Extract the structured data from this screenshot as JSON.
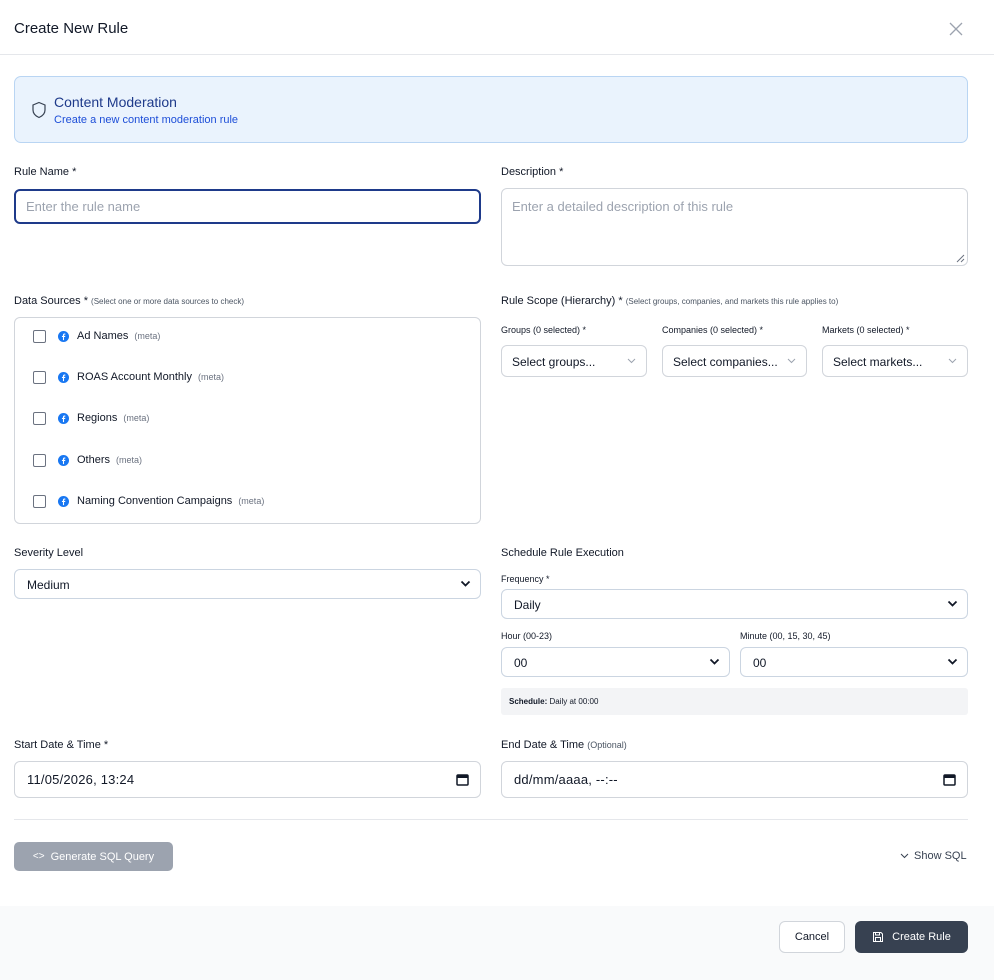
{
  "modal": {
    "title": "Create New Rule"
  },
  "banner": {
    "title": "Content Moderation",
    "subtitle": "Create a new content moderation rule"
  },
  "rule_name": {
    "label": "Rule Name *",
    "placeholder": "Enter the rule name",
    "value": ""
  },
  "description": {
    "label": "Description *",
    "placeholder": "Enter a detailed description of this rule",
    "value": ""
  },
  "data_sources": {
    "label": "Data Sources *",
    "hint": "(Select one or more data sources to check)",
    "items": [
      {
        "name": "Ad Names",
        "tag": "(meta)",
        "checked": false
      },
      {
        "name": "ROAS Account Monthly",
        "tag": "(meta)",
        "checked": false
      },
      {
        "name": "Regions",
        "tag": "(meta)",
        "checked": false
      },
      {
        "name": "Others",
        "tag": "(meta)",
        "checked": false
      },
      {
        "name": "Naming Convention Campaigns",
        "tag": "(meta)",
        "checked": false
      }
    ]
  },
  "rule_scope": {
    "label": "Rule Scope (Hierarchy) *",
    "hint": "(Select groups, companies, and markets this rule applies to)",
    "groups": {
      "label": "Groups (0 selected) *",
      "placeholder": "Select groups..."
    },
    "companies": {
      "label": "Companies (0 selected) *",
      "placeholder": "Select companies..."
    },
    "markets": {
      "label": "Markets (0 selected) *",
      "placeholder": "Select markets..."
    }
  },
  "severity": {
    "label": "Severity Level",
    "value": "Medium"
  },
  "schedule": {
    "label": "Schedule Rule Execution",
    "frequency_label": "Frequency *",
    "frequency_value": "Daily",
    "hour_label": "Hour (00-23)",
    "hour_value": "00",
    "minute_label": "Minute (00, 15, 30, 45)",
    "minute_value": "00",
    "note_prefix": "Schedule:",
    "note_text": "Daily at 00:00"
  },
  "start_datetime": {
    "label": "Start Date & Time *",
    "value": "11/05/2026, 13:24"
  },
  "end_datetime": {
    "label": "End Date & Time",
    "hint": "(Optional)",
    "value": "dd/mm/aaaa, --:--"
  },
  "actions": {
    "generate_sql": "Generate SQL Query",
    "show_sql": "Show SQL",
    "cancel": "Cancel",
    "create": "Create Rule"
  },
  "colors": {
    "primary": "#374151",
    "banner_bg": "#eaf3fd",
    "banner_border": "#b9d5f3",
    "focus": "#1e3a8a",
    "facebook": "#1877f2"
  }
}
